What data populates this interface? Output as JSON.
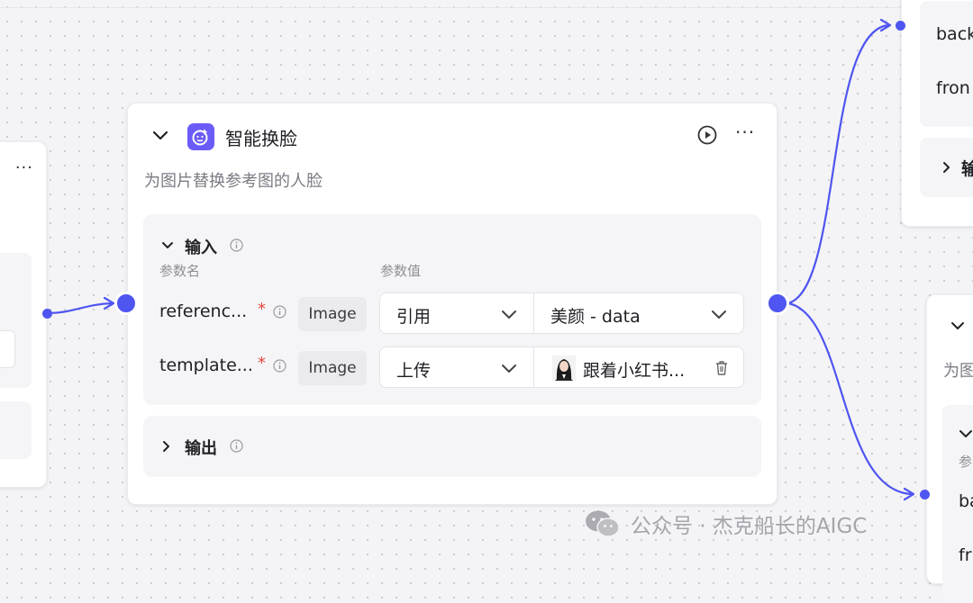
{
  "main_node": {
    "title": "智能换脸",
    "description": "为图片替换参考图的人脸",
    "input_section": {
      "title": "输入",
      "col_param_name": "参数名",
      "col_param_value": "参数值",
      "params": [
        {
          "name": "referenc...",
          "required": "*",
          "type": "Image",
          "mode": "引用",
          "value": "美颜 - data"
        },
        {
          "name": "template...",
          "required": "*",
          "type": "Image",
          "mode": "上传",
          "value": "跟着小红书..."
        }
      ]
    },
    "output_section": {
      "title": "输出"
    }
  },
  "right_top_node": {
    "line1": "back",
    "line2": "fron",
    "section_title": "输"
  },
  "right_bottom_node": {
    "description": "为图",
    "col_label": "参",
    "line1": "ba",
    "line2": "fr"
  },
  "watermark": "公众号 · 杰克船长的AIGC",
  "colors": {
    "accent": "#4f55f0",
    "icon_badge": "#6b5cf7",
    "required": "#e5483f"
  }
}
